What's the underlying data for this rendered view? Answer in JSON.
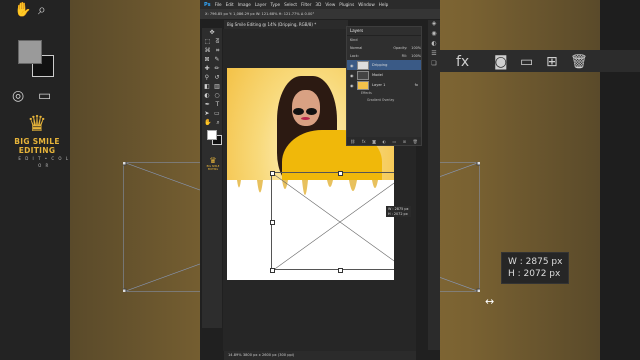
{
  "menu": {
    "ps": "Ps",
    "items": [
      "File",
      "Edit",
      "Image",
      "Layer",
      "Type",
      "Select",
      "Filter",
      "3D",
      "View",
      "Plugins",
      "Window",
      "Help"
    ]
  },
  "options": "X: 796.85 px   Y: 1,086.29 px   W: 121.68%   H: 121.77%   Δ 0.00°",
  "tab": "Big Smile Editing @ 14% (Dripping, RGB/8) *",
  "status": "14.89%     3800 px x 2600 px (300 ppi)",
  "brand": {
    "logo": "♛",
    "name": "BIG SMILE EDITING",
    "sub": "E D I T   •   C O L O R"
  },
  "layers": {
    "title": "Layers",
    "kind": "Kind",
    "mode": "Normal",
    "opacity_label": "Opacity:",
    "opacity": "100%",
    "lock_label": "Lock:",
    "fill_label": "Fill:",
    "fill": "100%",
    "rows": [
      {
        "name": "Dripping",
        "selected": true
      },
      {
        "name": "Model",
        "selected": false
      },
      {
        "name": "Layer 1",
        "selected": false,
        "fx": "fx"
      }
    ],
    "effects": "Effects",
    "gradient": "Gradient Overlay"
  },
  "transform": {
    "w": "W :  2875 px",
    "h": "H :  2072 px"
  },
  "transform_small": {
    "w": "W : 2875 px",
    "h": "H : 2072 px"
  },
  "colors": {
    "accent": "#31a8ff",
    "brand_gold": "#e7b43a",
    "selection": "#3a5a86"
  }
}
